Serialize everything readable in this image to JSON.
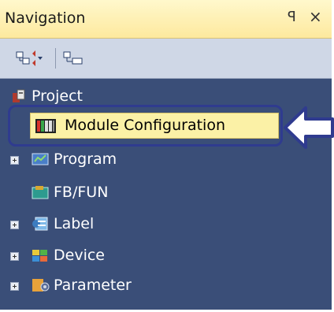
{
  "panel": {
    "title": "Navigation",
    "pin_glyph": "ꟼ",
    "close_glyph": "×"
  },
  "toolbar": {
    "buttons": [
      {
        "icon": "tree-expand-collapse-icon"
      },
      {
        "icon": "tree-view-icon"
      }
    ]
  },
  "tree": {
    "items": [
      {
        "label": "Project",
        "icon": "project-icon",
        "expandable": false
      },
      {
        "label": "Module Configuration",
        "icon": "module-configuration-icon",
        "selected": true
      },
      {
        "label": "Program",
        "icon": "program-icon",
        "expandable": true
      },
      {
        "label": "FB/FUN",
        "icon": "fb-fun-icon",
        "expandable": false
      },
      {
        "label": "Label",
        "icon": "label-icon",
        "expandable": true
      },
      {
        "label": "Device",
        "icon": "device-icon",
        "expandable": true
      },
      {
        "label": "Parameter",
        "icon": "parameter-icon",
        "expandable": true
      }
    ]
  },
  "callout": {
    "color": "#2f3b8f",
    "highlight_color": "#fbf1a6"
  }
}
